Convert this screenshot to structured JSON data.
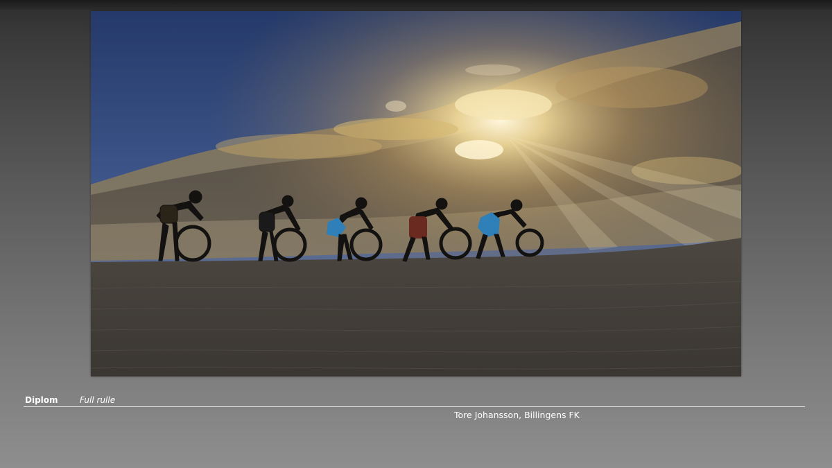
{
  "slide": {
    "award": "Diplom",
    "title": "Full rulle",
    "author": "Tore Johansson, Billingens FK"
  },
  "photo": {
    "subject": "silhouettes of five children rolling tyres along a sand dune at sunset",
    "figure_count": 5
  },
  "colors": {
    "sky_top": "#2a3f6e",
    "sky_low": "#6a7aa0",
    "cloud_gold": "#d8b870",
    "sun_glow": "#fff4d0",
    "sand": "#4a4540",
    "silhouette": "#141210",
    "shorts_blue": "#2f7fb8",
    "shorts_red": "#6a2a20",
    "caption_text": "#ffffff"
  }
}
